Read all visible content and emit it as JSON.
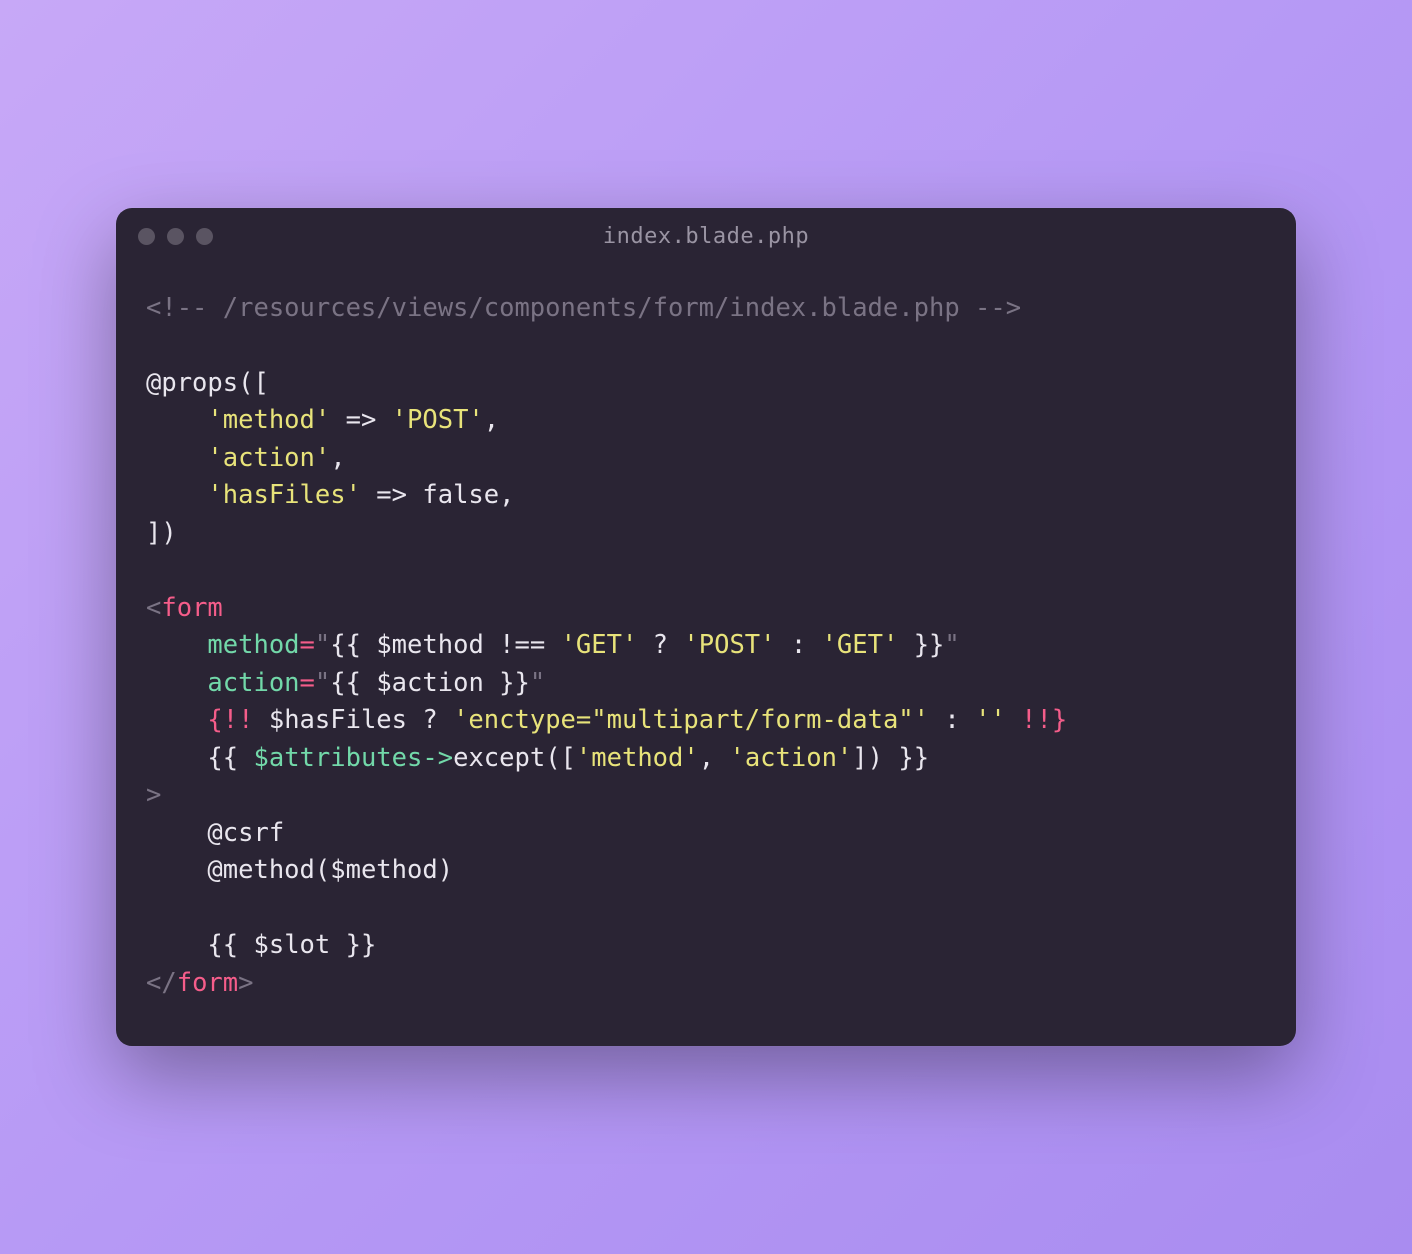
{
  "window": {
    "title": "index.blade.php"
  },
  "code": {
    "comment": "<!-- /resources/views/components/form/index.blade.php -->",
    "propsOpen": "@props([",
    "propMethodKey": "'method'",
    "arrow": " => ",
    "propMethodVal": "'POST'",
    "comma": ",",
    "propActionKey": "'action'",
    "propHasFilesKey": "'hasFiles'",
    "propHasFilesVal": "false",
    "propsClose": "])",
    "lt": "<",
    "gt": ">",
    "slash": "/",
    "formTag": "form",
    "attrMethod": "method",
    "eq": "=",
    "q": "\"",
    "bladeOpen": "{{ ",
    "bladeClose": " }}",
    "bladeRawOpen": "{!! ",
    "bladeRawClose": " !!}",
    "methodExpr1": "$method !== ",
    "getStr": "'GET'",
    "postStr": "'POST'",
    "qmark": " ? ",
    "colon": " : ",
    "attrAction": "action",
    "actionVar": "$action",
    "hasFilesVar": "$hasFiles",
    "enctypeStr": "'enctype=\"multipart/form-data\"'",
    "emptyStr": "''",
    "attributesVar": "$attributes",
    "thinArrow": "->",
    "exceptCall": "except([",
    "methodStr": "'method'",
    "commaSpace": ", ",
    "actionStr": "'action'",
    "exceptEnd": "])",
    "csrf": "@csrf",
    "methodDir": "@method($method)",
    "slotExpr": "$slot",
    "indent": "    "
  }
}
